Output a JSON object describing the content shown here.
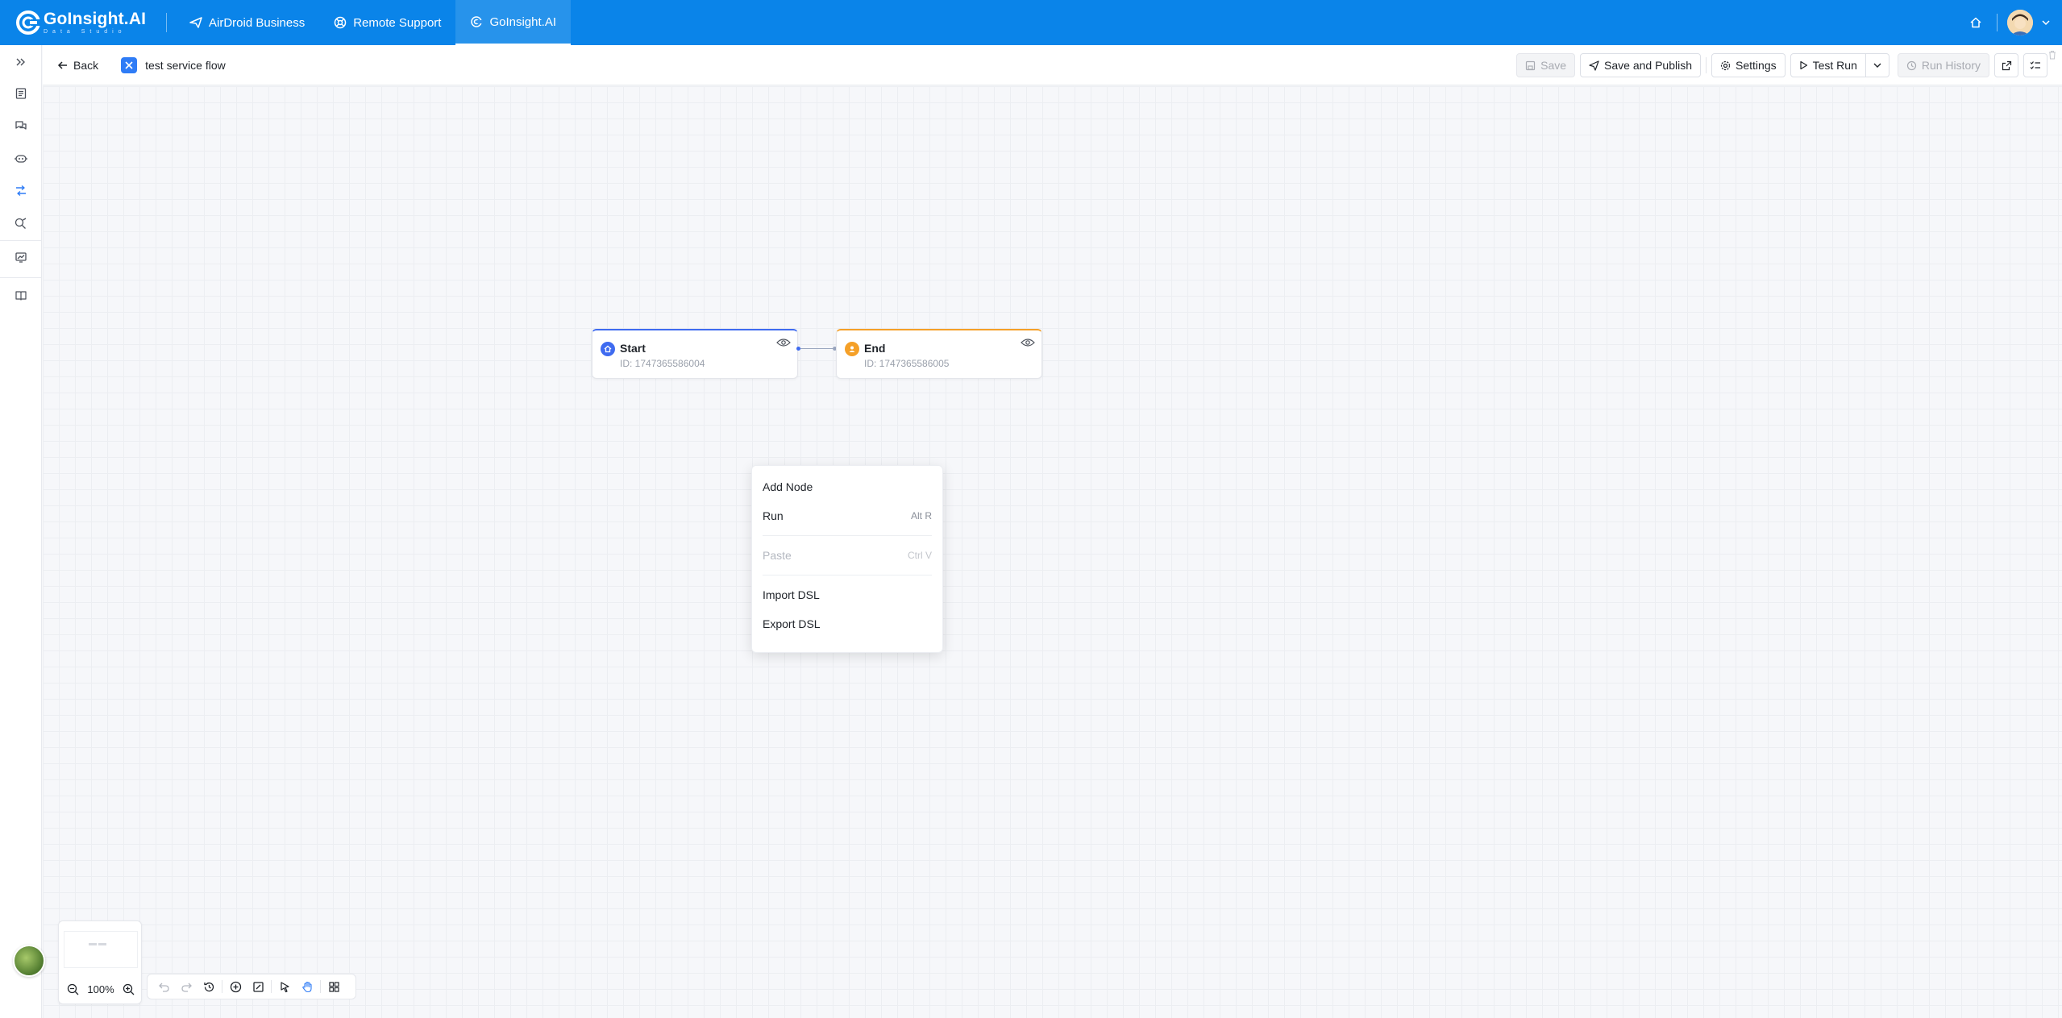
{
  "brand": {
    "name": "GoInsight.AI",
    "sub": "Data Studio"
  },
  "top_tabs": [
    {
      "label": "AirDroid Business",
      "icon": "paper-plane-icon"
    },
    {
      "label": "Remote Support",
      "icon": "lifebuoy-icon"
    },
    {
      "label": "GoInsight.AI",
      "icon": "goinsight-icon"
    }
  ],
  "subheader": {
    "back_label": "Back",
    "flow_name": "test service flow",
    "save_label": "Save",
    "save_publish_label": "Save and Publish",
    "settings_label": "Settings",
    "test_run_label": "Test Run",
    "run_history_label": "Run History"
  },
  "nodes": {
    "start": {
      "title": "Start",
      "id_text": "ID: 1747365586004"
    },
    "end": {
      "title": "End",
      "id_text": "ID: 1747365586005"
    }
  },
  "context_menu": {
    "add_node": "Add Node",
    "run": "Run",
    "run_shortcut": "Alt R",
    "paste": "Paste",
    "paste_shortcut": "Ctrl V",
    "import_dsl": "Import DSL",
    "export_dsl": "Export DSL"
  },
  "zoom": {
    "level": "100%"
  },
  "colors": {
    "topbar": "#0a84e9",
    "start_accent": "#3f6bf0",
    "end_accent": "#f5a028"
  }
}
